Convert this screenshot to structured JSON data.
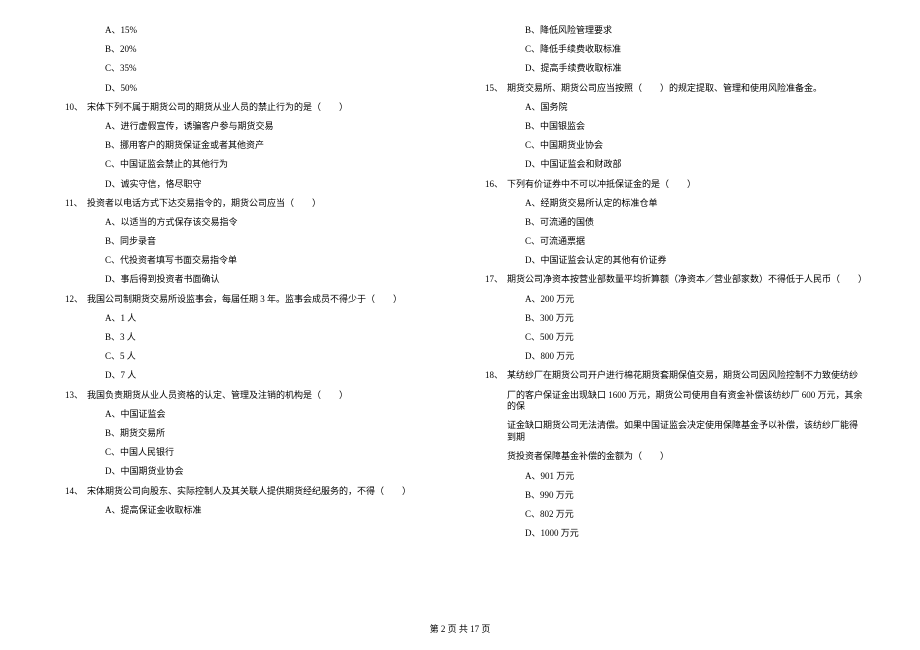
{
  "left_column": {
    "opt_A": "A、15%",
    "opt_B": "B、20%",
    "opt_C": "C、35%",
    "opt_D": "D、50%",
    "q10_num": "10、",
    "q10_text": "宋体下列不属于期货公司的期货从业人员的禁止行为的是（　　）",
    "q10_A": "A、进行虚假宣传，诱骗客户参与期货交易",
    "q10_B": "B、挪用客户的期货保证金或者其他资产",
    "q10_C": "C、中国证监会禁止的其他行为",
    "q10_D": "D、诚实守信，恪尽职守",
    "q11_num": "11、",
    "q11_text": "投资者以电话方式下达交易指令的，期货公司应当（　　）",
    "q11_A": "A、以适当的方式保存该交易指令",
    "q11_B": "B、同步录音",
    "q11_C": "C、代投资者填写书面交易指令单",
    "q11_D": "D、事后得到投资者书面确认",
    "q12_num": "12、",
    "q12_text": "我国公司制期货交易所设监事会，每届任期 3 年。监事会成员不得少于（　　）",
    "q12_A": "A、1 人",
    "q12_B": "B、3 人",
    "q12_C": "C、5 人",
    "q12_D": "D、7 人",
    "q13_num": "13、",
    "q13_text": "我国负责期货从业人员资格的认定、管理及注销的机构是（　　）",
    "q13_A": "A、中国证监会",
    "q13_B": "B、期货交易所",
    "q13_C": "C、中国人民银行",
    "q13_D": "D、中国期货业协会",
    "q14_num": "14、",
    "q14_text": "宋体期货公司向股东、实际控制人及其关联人提供期货经纪服务的，不得（　　）",
    "q14_A": "A、提高保证金收取标准"
  },
  "right_column": {
    "q14_B": "B、降低风险管理要求",
    "q14_C": "C、降低手续费收取标准",
    "q14_D": "D、提高手续费收取标准",
    "q15_num": "15、",
    "q15_text": "期货交易所、期货公司应当按照（　　）的规定提取、管理和使用风险准备金。",
    "q15_A": "A、国务院",
    "q15_B": "B、中国银监会",
    "q15_C": "C、中国期货业协会",
    "q15_D": "D、中国证监会和财政部",
    "q16_num": "16、",
    "q16_text": "下列有价证券中不可以冲抵保证金的是（　　）",
    "q16_A": "A、经期货交易所认定的标准仓单",
    "q16_B": "B、可流通的国债",
    "q16_C": "C、可流通票据",
    "q16_D": "D、中国证监会认定的其他有价证券",
    "q17_num": "17、",
    "q17_text": "期货公司净资本按营业部数量平均折算额（净资本／营业部家数）不得低于人民币（　　）",
    "q17_A": "A、200 万元",
    "q17_B": "B、300 万元",
    "q17_C": "C、500 万元",
    "q17_D": "D、800 万元",
    "q18_num": "18、",
    "q18_text": "某纺纱厂在期货公司开户进行棉花期货套期保值交易，期货公司因风险控制不力致使纺纱",
    "q18_cont1": "厂的客户保证金出现缺口 1600 万元，期货公司使用自有资金补偿该纺纱厂 600 万元，其余的保",
    "q18_cont2": "证金缺口期货公司无法清偿。如果中国证监会决定使用保障基金予以补偿，该纺纱厂能得到期",
    "q18_cont3": "货投资者保障基金补偿的金额为（　　）",
    "q18_A": "A、901 万元",
    "q18_B": "B、990 万元",
    "q18_C": "C、802 万元",
    "q18_D": "D、1000 万元"
  },
  "footer": "第 2 页 共 17 页"
}
